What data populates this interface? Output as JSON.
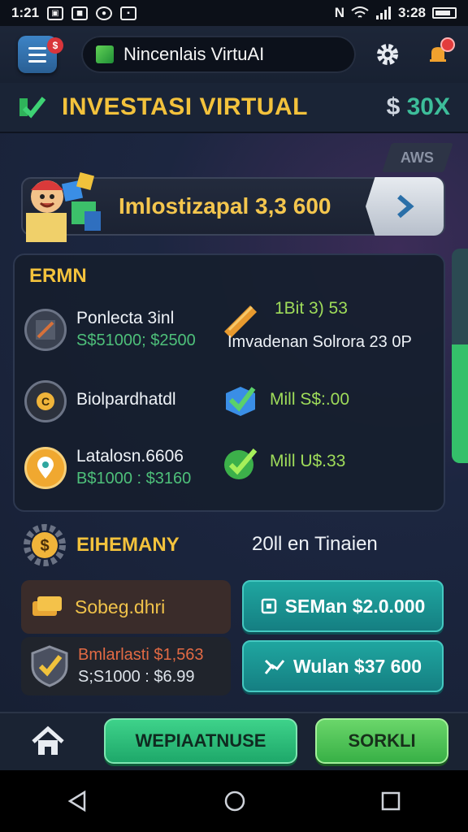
{
  "status_bar": {
    "time_left": "1:21",
    "time_right": "3:28"
  },
  "app_bar": {
    "menu_badge": "$",
    "title": "Nincenlais VirtuAI"
  },
  "header": {
    "title": "INVESTASI VIRTUAL",
    "amount_symbol": "$",
    "amount_value": "30X"
  },
  "main": {
    "tag": "AWS",
    "banner_text": "Imlostizapal 3,3 600",
    "panel_title": "ERMN",
    "stats_left": [
      {
        "label": "Ponlecta 3inl",
        "value": "S$51000; $2500"
      },
      {
        "label": "Biolpardhatdl",
        "value": ""
      },
      {
        "label": "Latalosn.6606",
        "value": "B$1000 : $3160"
      }
    ],
    "stats_right": [
      {
        "label": "1Bit 3) 53",
        "value": "Imvadenan Solrora 23 0P"
      },
      {
        "label": "Mill S$:.00",
        "value": ""
      },
      {
        "label": "Mill U$.33",
        "value": ""
      }
    ],
    "section_title": "EIHEMANY",
    "section_right": "20ll en Tinaien",
    "card_dark1": "Sobeg.dhri",
    "card_dark2_l1": "Bmlarlasti $1,563",
    "card_dark2_l2": "S;S1000 : $6.99",
    "card_teal1": "SEMan $2.0.000",
    "card_teal2": "Wulan $37 600"
  },
  "bottom": {
    "btn_primary": "WEPIAATNUSE",
    "btn_secondary": "SORKLI"
  },
  "colors": {
    "accent_gold": "#f3c23c",
    "accent_green": "#4ec07a",
    "accent_teal": "#1fa6a0"
  }
}
